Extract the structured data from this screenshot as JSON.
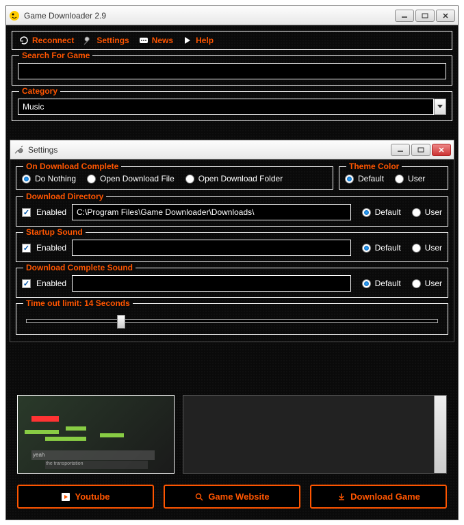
{
  "mainWindow": {
    "title": "Game Downloader 2.9",
    "toolbar": {
      "reconnect": "Reconnect",
      "settings": "Settings",
      "news": "News",
      "help": "Help"
    },
    "searchGroup": "Search For Game",
    "searchValue": "",
    "categoryGroup": "Category",
    "categoryValue": "Music",
    "buttons": {
      "youtube": "Youtube",
      "website": "Game Website",
      "download": "Download Game"
    }
  },
  "settingsWindow": {
    "title": "Settings",
    "onComplete": {
      "label": "On Download Complete",
      "doNothing": "Do Nothing",
      "openFile": "Open Download File",
      "openFolder": "Open Download Folder"
    },
    "themeColor": {
      "label": "Theme Color",
      "default": "Default",
      "user": "User"
    },
    "directory": {
      "label": "Download Directory",
      "enabled": "Enabled",
      "path": "C:\\Program Files\\Game Downloader\\Downloads\\",
      "default": "Default",
      "user": "User"
    },
    "startupSound": {
      "label": "Startup Sound",
      "enabled": "Enabled",
      "default": "Default",
      "user": "User"
    },
    "completeSound": {
      "label": "Download Complete Sound",
      "enabled": "Enabled",
      "default": "Default",
      "user": "User"
    },
    "timeout": {
      "label": "Time out limit: 14 Seconds"
    }
  }
}
